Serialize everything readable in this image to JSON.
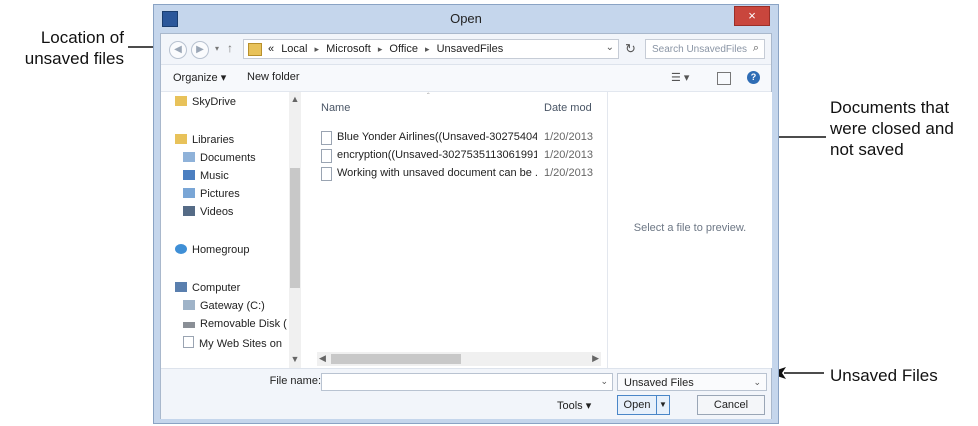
{
  "annotations": {
    "location": [
      "Location of",
      "unsaved files"
    ],
    "documents": [
      "Documents that",
      "were closed and",
      "not saved"
    ],
    "unsaved_files": "Unsaved Files"
  },
  "dialog": {
    "title": "Open",
    "close_label": "×"
  },
  "address": {
    "prefix": "«",
    "crumbs": [
      "Local",
      "Microsoft",
      "Office",
      "UnsavedFiles"
    ],
    "separator": "▸"
  },
  "search": {
    "placeholder": "Search UnsavedFiles"
  },
  "toolbar": {
    "organize": "Organize ▾",
    "new_folder": "New folder"
  },
  "nav": {
    "skydrive": "SkyDrive",
    "libraries": "Libraries",
    "documents": "Documents",
    "music": "Music",
    "pictures": "Pictures",
    "videos": "Videos",
    "homegroup": "Homegroup",
    "computer": "Computer",
    "gateway": "Gateway (C:)",
    "removable": "Removable Disk (",
    "websites": "My Web Sites on"
  },
  "files": {
    "columns": {
      "name": "Name",
      "date": "Date mod"
    },
    "rows": [
      {
        "name": "Blue Yonder Airlines((Unsaved-30275404...",
        "date": "1/20/2013"
      },
      {
        "name": "encryption((Unsaved-3027535113061991...",
        "date": "1/20/2013"
      },
      {
        "name": "Working with unsaved document can be ...",
        "date": "1/20/2013"
      }
    ]
  },
  "preview": {
    "message": "Select a file to preview."
  },
  "bottom": {
    "file_name_label": "File name:",
    "file_name_value": "",
    "file_type": "Unsaved Files",
    "tools": "Tools ▾",
    "open": "Open",
    "cancel": "Cancel"
  },
  "colors": {
    "dialog_frame": "#c5d6ec",
    "close_button": "#c9463d",
    "folder": "#e8c25a"
  }
}
